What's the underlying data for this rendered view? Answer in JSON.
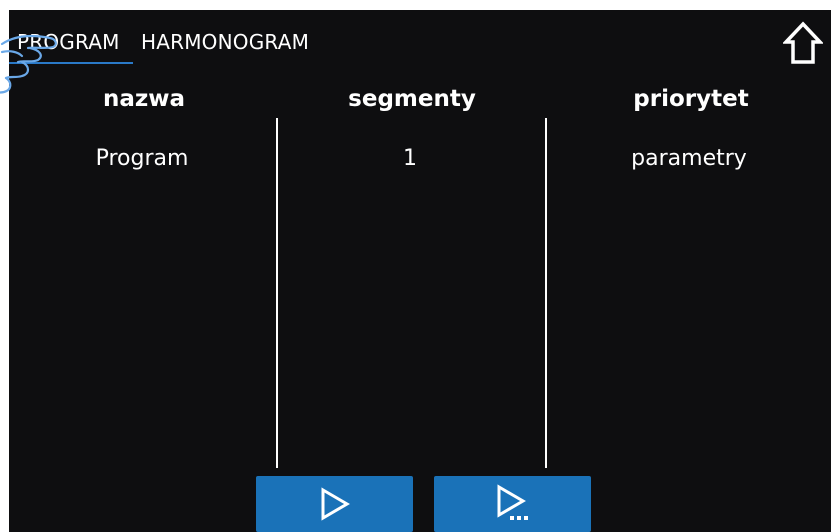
{
  "tabs": [
    {
      "label": "PROGRAM",
      "active": true
    },
    {
      "label": "HARMONOGRAM",
      "active": false
    }
  ],
  "columns": {
    "name_header": "nazwa",
    "segments_header": "segmenty",
    "priority_header": "priorytet"
  },
  "row": {
    "name": "Program",
    "segments": "1",
    "priority": "parametry"
  },
  "icons": {
    "home": "home-icon",
    "run": "play-icon",
    "run_options": "play-options-icon",
    "hand": "hand-pointer-icon"
  },
  "colors": {
    "background": "#0e0e10",
    "accent": "#1a72b8",
    "tab_underline": "#2a79c8",
    "text": "#ffffff"
  }
}
